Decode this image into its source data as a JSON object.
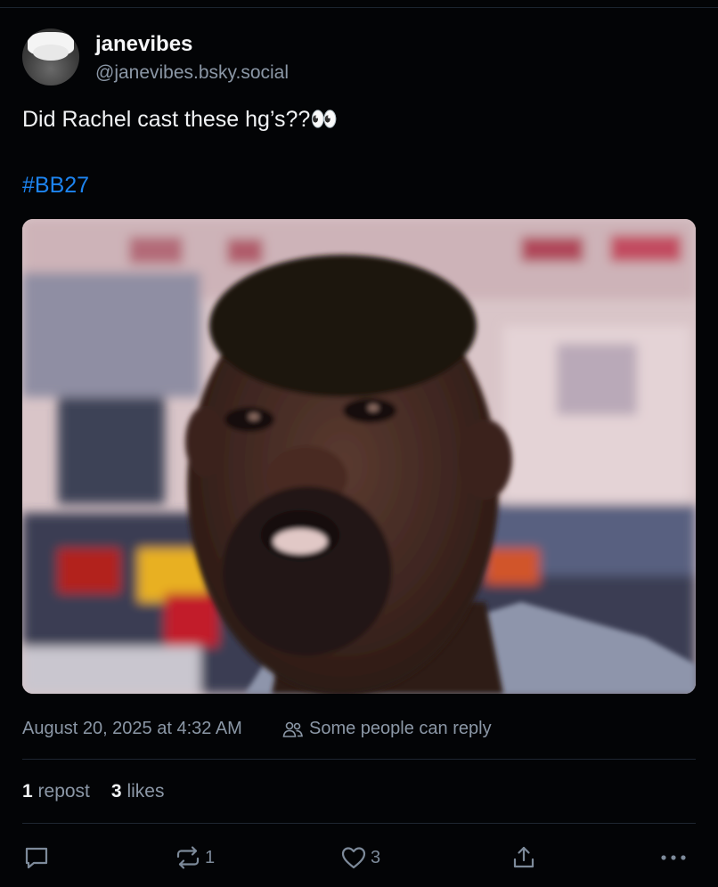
{
  "author": {
    "display_name": "janevibes",
    "handle": "@janevibes.bsky.social"
  },
  "post": {
    "text": "Did Rachel cast these hg’s??👀",
    "hashtag": "#BB27"
  },
  "meta": {
    "timestamp": "August 20, 2025 at 4:32 AM",
    "reply_setting": "Some people can reply"
  },
  "stats": {
    "reposts_count": "1",
    "reposts_label": "repost",
    "likes_count": "3",
    "likes_label": "likes"
  },
  "actions": {
    "repost_count": "1",
    "like_count": "3"
  },
  "colors": {
    "background": "#030406",
    "link": "#1d84f0",
    "muted": "#8b97a6"
  }
}
